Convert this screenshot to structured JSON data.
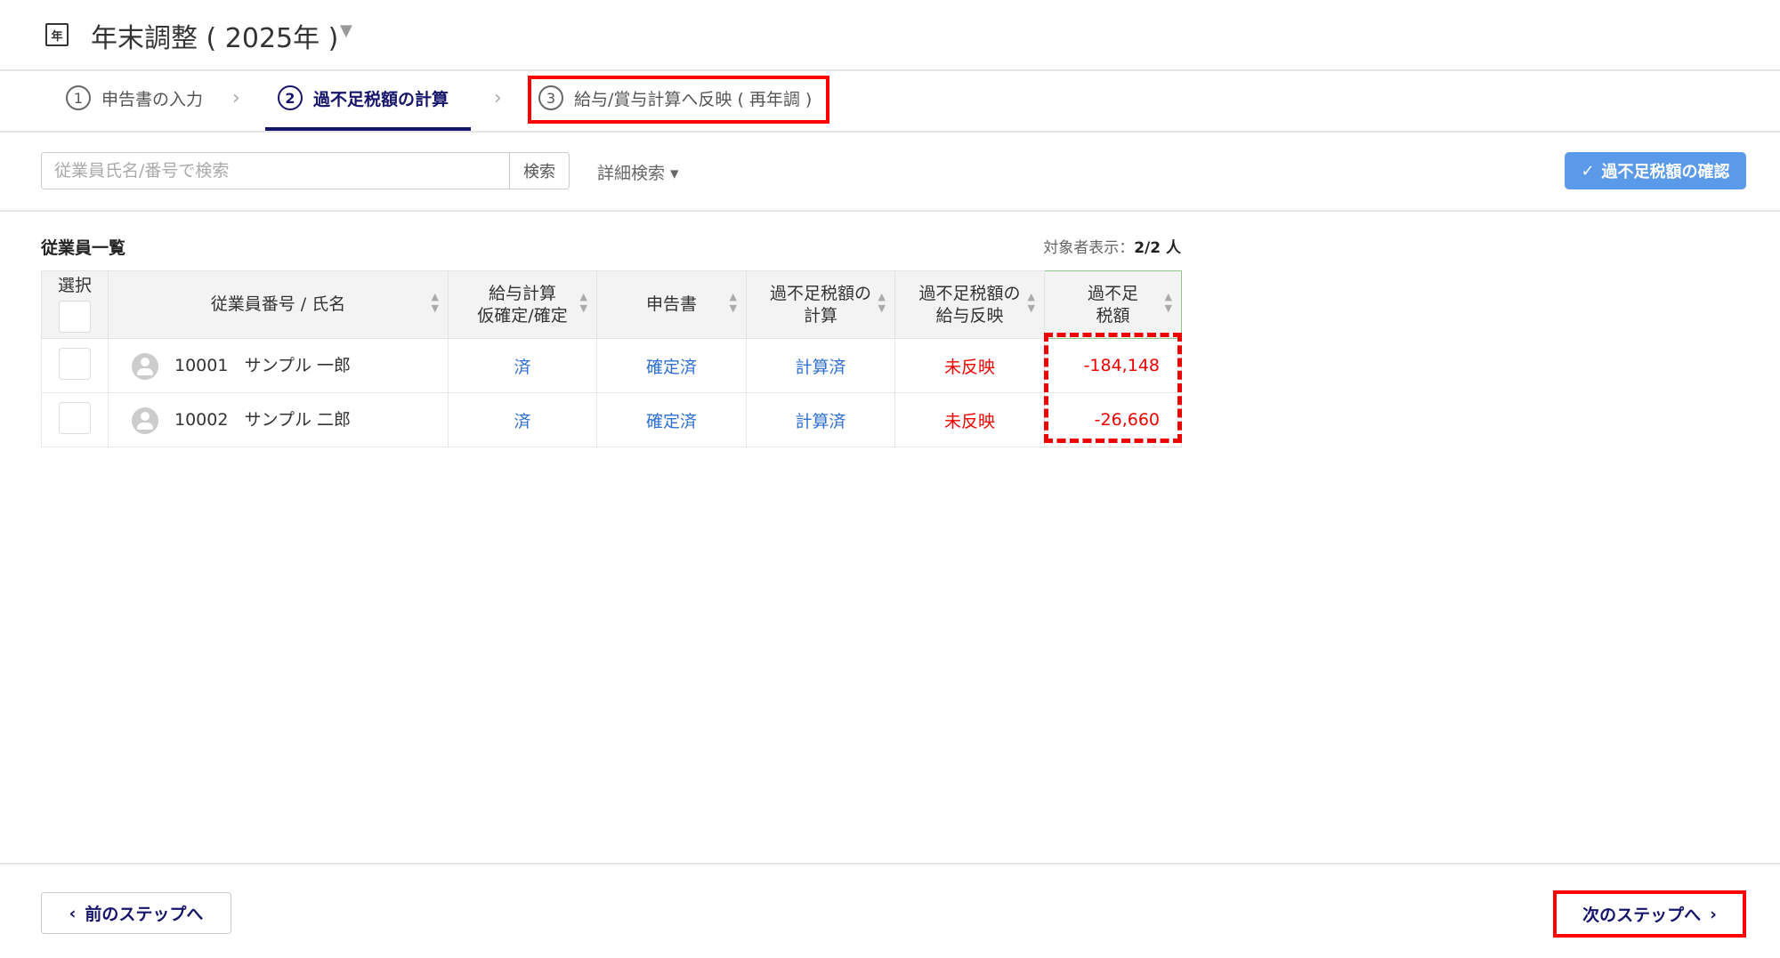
{
  "header": {
    "icon_text": "年",
    "title": "年末調整 ( 2025年 )",
    "caret": "▼"
  },
  "steps": [
    {
      "num": "1",
      "label": "申告書の入力"
    },
    {
      "num": "2",
      "label": "過不足税額の計算"
    },
    {
      "num": "3",
      "label": "給与/賞与計算へ反映 ( 再年調 )"
    }
  ],
  "toolbar": {
    "search_placeholder": "従業員氏名/番号で検索",
    "search_button": "検索",
    "advanced_search": "詳細検索 ▾",
    "confirm_button": "過不足税額の確認",
    "confirm_icon": "✓"
  },
  "list": {
    "title": "従業員一覧",
    "count_label": "対象者表示：",
    "count_value": "2/2 人"
  },
  "table": {
    "headers": [
      "選択",
      "従業員番号 / 氏名",
      "給与計算\n仮確定/確定",
      "申告書",
      "過不足税額の\n計算",
      "過不足税額の\n給与反映",
      "過不足\n税額"
    ],
    "rows": [
      {
        "id": "10001",
        "name": "サンプル 一郎",
        "payroll": "済",
        "declaration": "確定済",
        "calc": "計算済",
        "reflect": "未反映",
        "amount": "-184,148"
      },
      {
        "id": "10002",
        "name": "サンプル 二郎",
        "payroll": "済",
        "declaration": "確定済",
        "calc": "計算済",
        "reflect": "未反映",
        "amount": "-26,660"
      }
    ]
  },
  "footer": {
    "prev": "前のステップへ",
    "next": "次のステップへ"
  },
  "colors": {
    "navy": "#15156b",
    "accent": "#5a9ae8",
    "link": "#2f6fd0",
    "alert": "#e00000"
  }
}
